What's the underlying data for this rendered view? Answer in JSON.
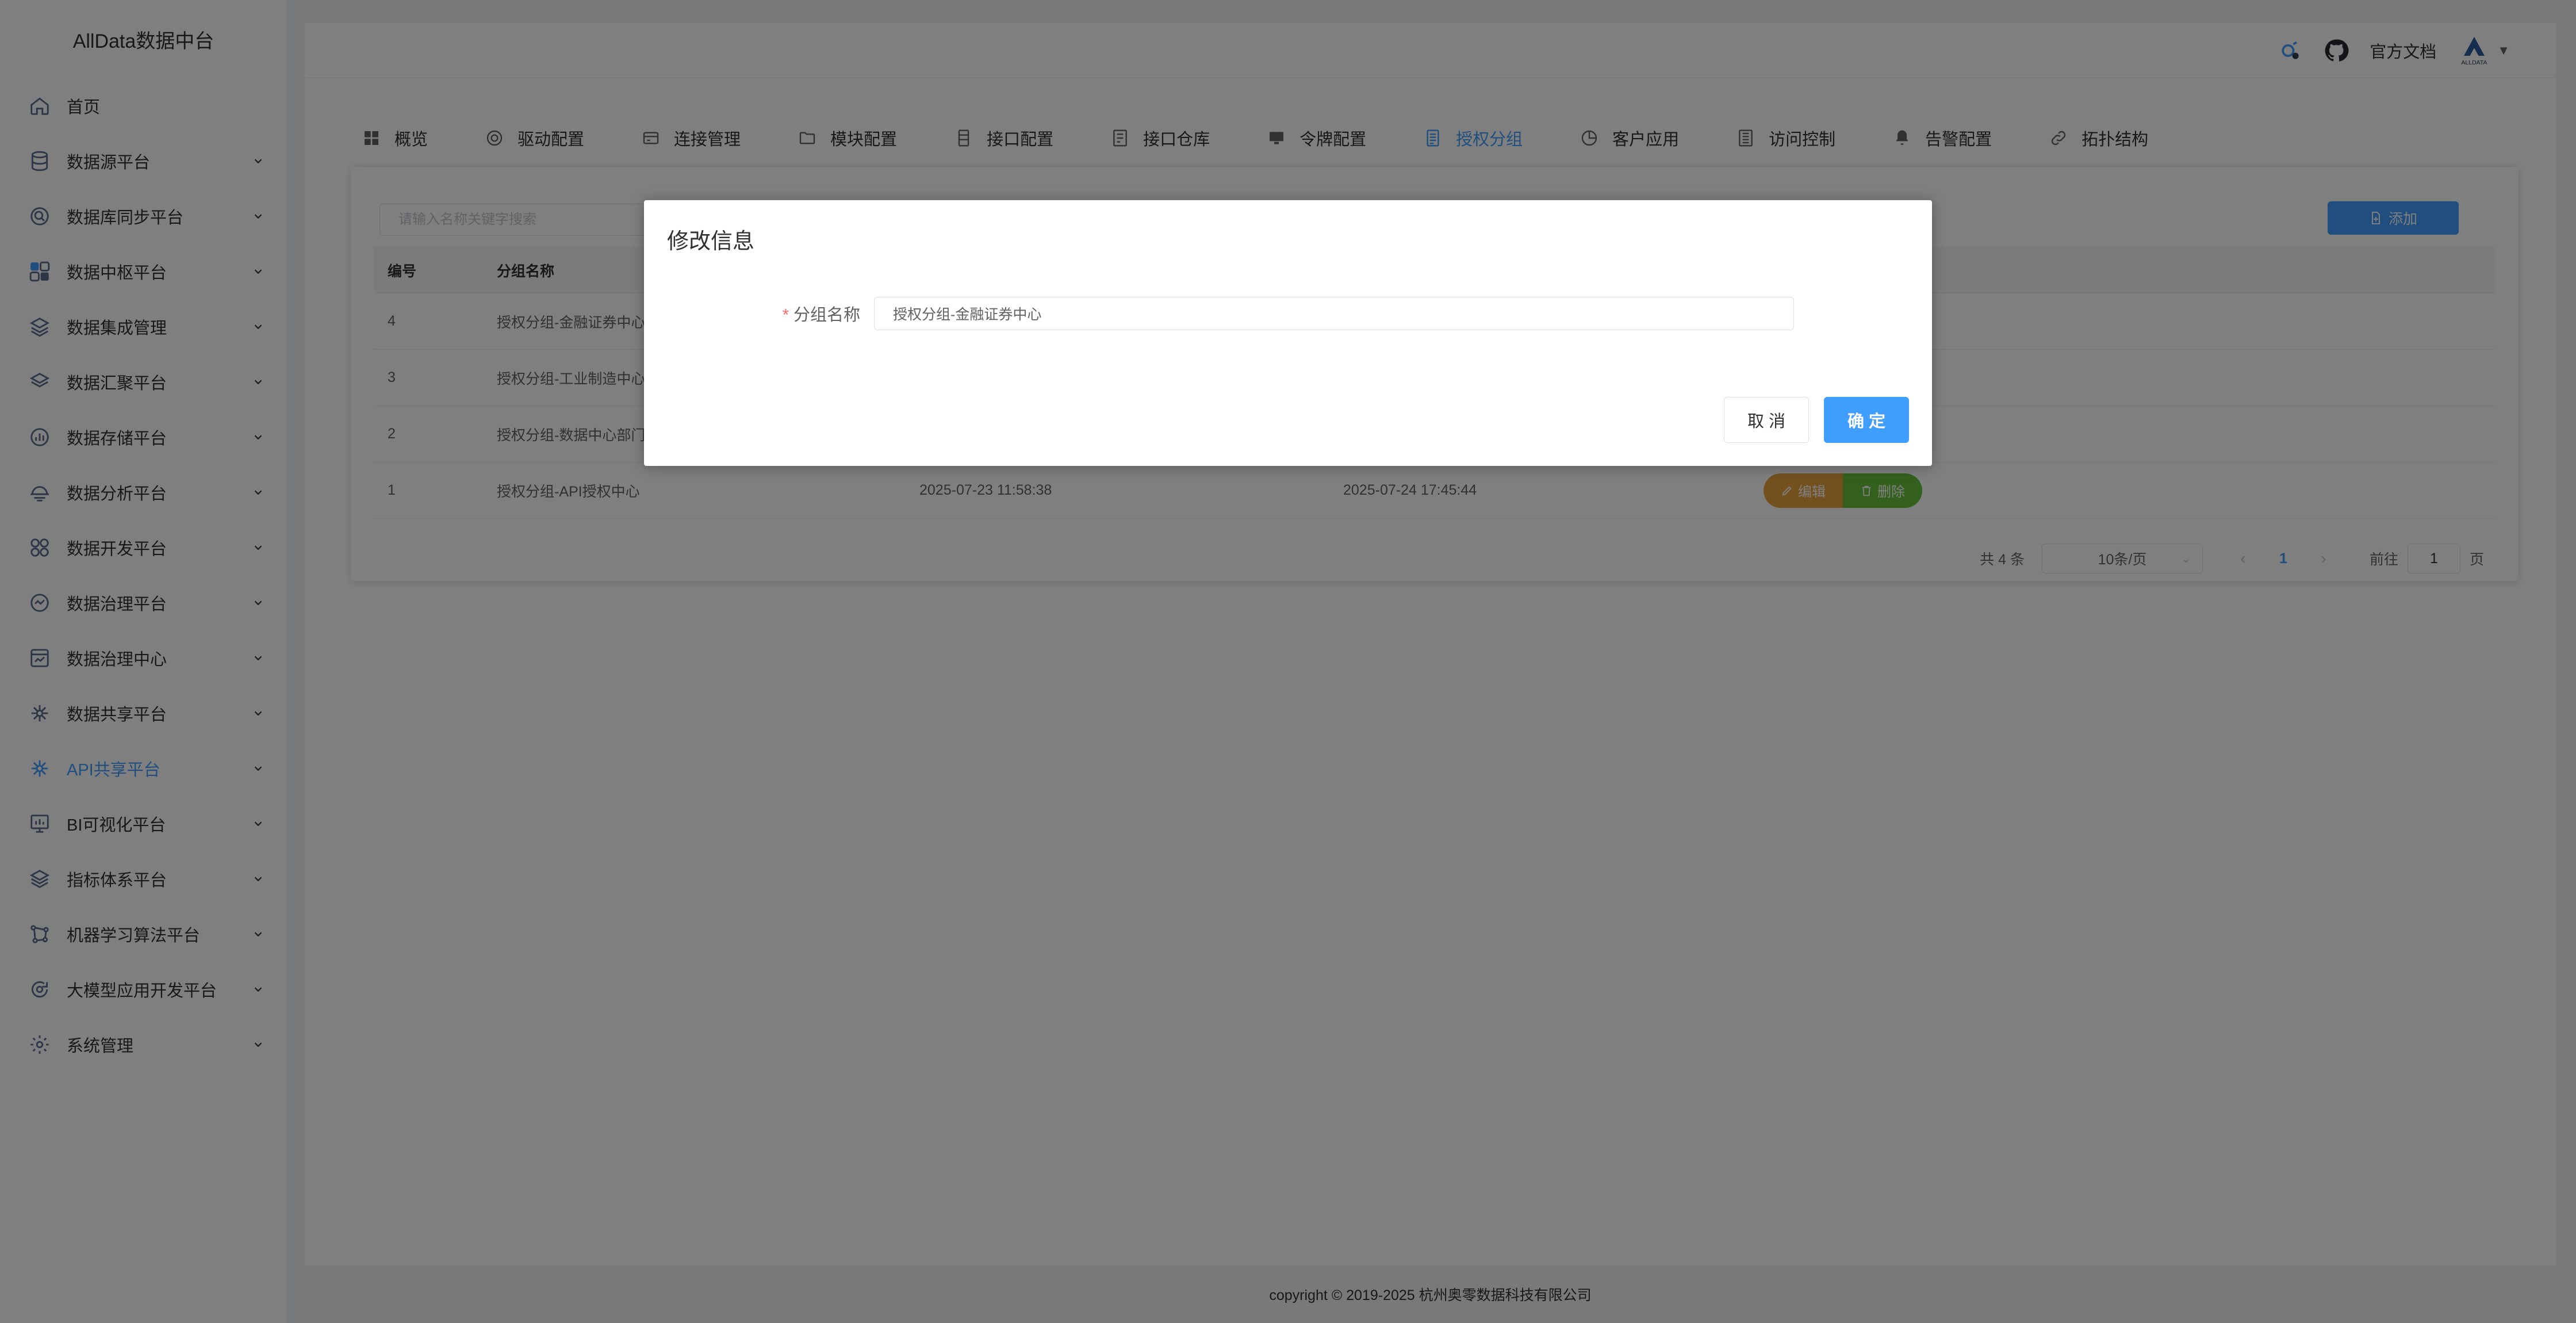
{
  "brand": "AllData数据中台",
  "sidebar": {
    "items": [
      {
        "label": "首页",
        "icon": "home-icon",
        "arrow": false
      },
      {
        "label": "数据源平台",
        "icon": "database-icon",
        "arrow": true
      },
      {
        "label": "数据库同步平台",
        "icon": "sync-search-icon",
        "arrow": true
      },
      {
        "label": "数据中枢平台",
        "icon": "grid-icon",
        "arrow": true
      },
      {
        "label": "数据集成管理",
        "icon": "layers-icon",
        "arrow": true
      },
      {
        "label": "数据汇聚平台",
        "icon": "stack-icon",
        "arrow": true
      },
      {
        "label": "数据存储平台",
        "icon": "chart-icon",
        "arrow": true
      },
      {
        "label": "数据分析平台",
        "icon": "analysis-icon",
        "arrow": true
      },
      {
        "label": "数据开发平台",
        "icon": "dev-icon",
        "arrow": true
      },
      {
        "label": "数据治理平台",
        "icon": "shield-icon",
        "arrow": true
      },
      {
        "label": "数据治理中心",
        "icon": "monitor-icon",
        "arrow": true
      },
      {
        "label": "数据共享平台",
        "icon": "share-icon",
        "arrow": true
      },
      {
        "label": "API共享平台",
        "icon": "api-icon",
        "arrow": true,
        "active": true
      },
      {
        "label": "BI可视化平台",
        "icon": "bi-icon",
        "arrow": true
      },
      {
        "label": "指标体系平台",
        "icon": "index-icon",
        "arrow": true
      },
      {
        "label": "机器学习算法平台",
        "icon": "ml-icon",
        "arrow": true
      },
      {
        "label": "大模型应用开发平台",
        "icon": "llm-icon",
        "arrow": true
      },
      {
        "label": "系统管理",
        "icon": "settings-icon",
        "arrow": true
      }
    ]
  },
  "topbar": {
    "docs_label": "官方文档",
    "avatar_text": "ALLDATA"
  },
  "tabs": [
    {
      "label": "概览",
      "icon": "dashboard-icon"
    },
    {
      "label": "驱动配置",
      "icon": "driver-icon"
    },
    {
      "label": "连接管理",
      "icon": "connection-icon"
    },
    {
      "label": "模块配置",
      "icon": "folder-icon"
    },
    {
      "label": "接口配置",
      "icon": "interface-icon"
    },
    {
      "label": "接口仓库",
      "icon": "repository-icon"
    },
    {
      "label": "令牌配置",
      "icon": "token-icon"
    },
    {
      "label": "授权分组",
      "icon": "document-icon",
      "active": true
    },
    {
      "label": "客户应用",
      "icon": "pie-icon"
    },
    {
      "label": "访问控制",
      "icon": "access-icon"
    },
    {
      "label": "告警配置",
      "icon": "bell-icon"
    },
    {
      "label": "拓扑结构",
      "icon": "link-icon"
    }
  ],
  "search": {
    "placeholder": "请输入名称关键字搜索"
  },
  "add_button": "添加",
  "table": {
    "headers": [
      "编号",
      "分组名称"
    ],
    "rows": [
      {
        "id": "4",
        "name": "授权分组-金融证券中心",
        "created": "",
        "updated": ""
      },
      {
        "id": "3",
        "name": "授权分组-工业制造中心",
        "created": "",
        "updated": ""
      },
      {
        "id": "2",
        "name": "授权分组-数据中心部门",
        "created": "",
        "updated": ""
      },
      {
        "id": "1",
        "name": "授权分组-API授权中心",
        "created": "2025-07-23 11:58:38",
        "updated": "2025-07-24 17:45:44"
      }
    ],
    "edit_label": "编辑",
    "delete_label": "删除"
  },
  "pagination": {
    "total": "共 4 条",
    "page_size": "10条/页",
    "current_page": "1",
    "goto_label": "前往",
    "goto_value": "1",
    "page_suffix": "页"
  },
  "footer": "copyright © 2019-2025 杭州奥零数据科技有限公司",
  "dialog": {
    "title": "修改信息",
    "field_label": "分组名称",
    "field_value": "授权分组-金融证券中心",
    "cancel": "取 消",
    "confirm": "确 定"
  }
}
